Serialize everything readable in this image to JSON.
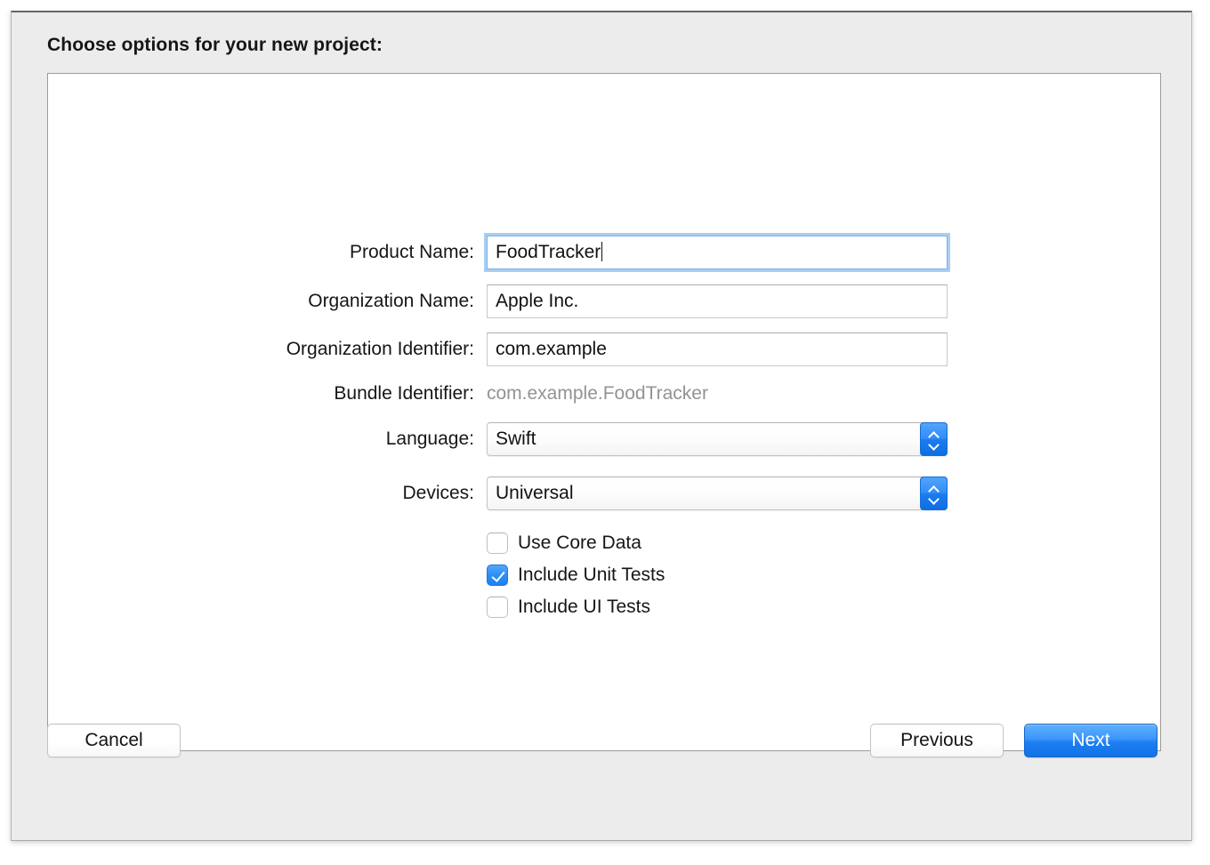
{
  "window": {
    "prompt": "Choose options for your new project:"
  },
  "form": {
    "fields": [
      {
        "label": "Product Name:",
        "value": "FoodTracker",
        "type": "text",
        "focused": true,
        "name": "product-name"
      },
      {
        "label": "Organization Name:",
        "value": "Apple Inc.",
        "type": "text",
        "focused": false,
        "name": "organization-name"
      },
      {
        "label": "Organization Identifier:",
        "value": "com.example",
        "type": "text",
        "focused": false,
        "name": "organization-identifier"
      },
      {
        "label": "Bundle Identifier:",
        "value": "com.example.FoodTracker",
        "type": "readonly",
        "focused": false,
        "name": "bundle-identifier"
      },
      {
        "label": "Language:",
        "value": "Swift",
        "type": "select",
        "focused": false,
        "name": "language"
      },
      {
        "label": "Devices:",
        "value": "Universal",
        "type": "select",
        "focused": false,
        "name": "devices"
      }
    ],
    "checkboxes": [
      {
        "label": "Use Core Data",
        "checked": false,
        "name": "use-core-data"
      },
      {
        "label": "Include Unit Tests",
        "checked": true,
        "name": "include-unit-tests"
      },
      {
        "label": "Include UI Tests",
        "checked": false,
        "name": "include-ui-tests"
      }
    ]
  },
  "footer": {
    "cancel": "Cancel",
    "previous": "Previous",
    "next": "Next"
  },
  "colors": {
    "accent": "#1d80f2",
    "focus_ring": "#74b0e9",
    "readonly_text": "#939393",
    "window_bg": "#ececec",
    "panel_bg": "#ffffff"
  }
}
